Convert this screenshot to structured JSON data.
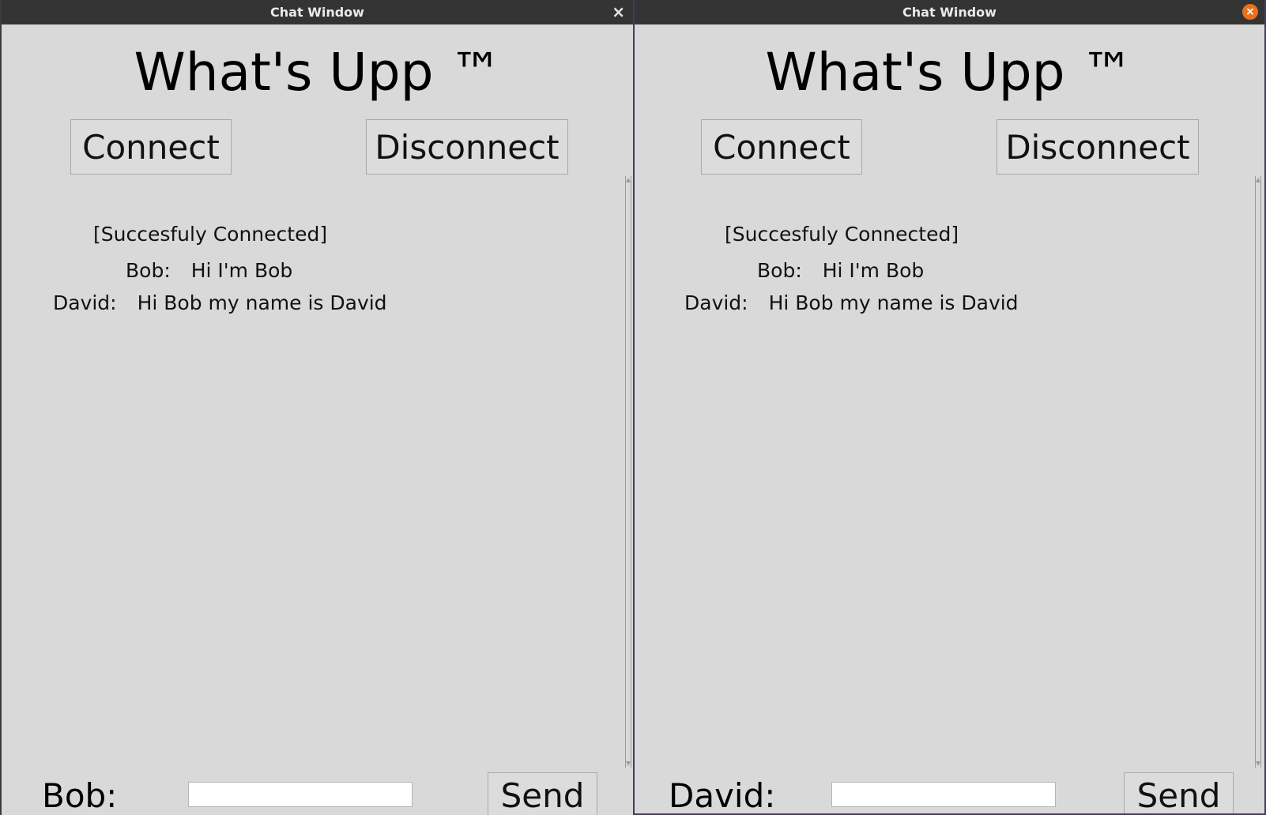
{
  "windows": [
    {
      "title": "Chat Window",
      "app_title": "What's Upp ™",
      "connect_label": "Connect",
      "disconnect_label": "Disconnect",
      "status": "[Succesfuly Connected]",
      "messages": [
        {
          "sender": "Bob:",
          "text": "Hi I'm Bob"
        },
        {
          "sender": "David:",
          "text": "Hi Bob my name is David"
        }
      ],
      "user_label": "Bob:",
      "input_value": "",
      "send_label": "Send",
      "close_icon": "close-icon"
    },
    {
      "title": "Chat Window",
      "app_title": "What's Upp ™",
      "connect_label": "Connect",
      "disconnect_label": "Disconnect",
      "status": "[Succesfuly Connected]",
      "messages": [
        {
          "sender": "Bob:",
          "text": "Hi I'm Bob"
        },
        {
          "sender": "David:",
          "text": "Hi Bob my name is David"
        }
      ],
      "user_label": "David:",
      "input_value": "",
      "send_label": "Send",
      "close_icon": "close-circle-icon"
    }
  ],
  "colors": {
    "titlebar": "#343434",
    "window_bg": "#d9d9d9",
    "close_orange": "#e8721c"
  }
}
